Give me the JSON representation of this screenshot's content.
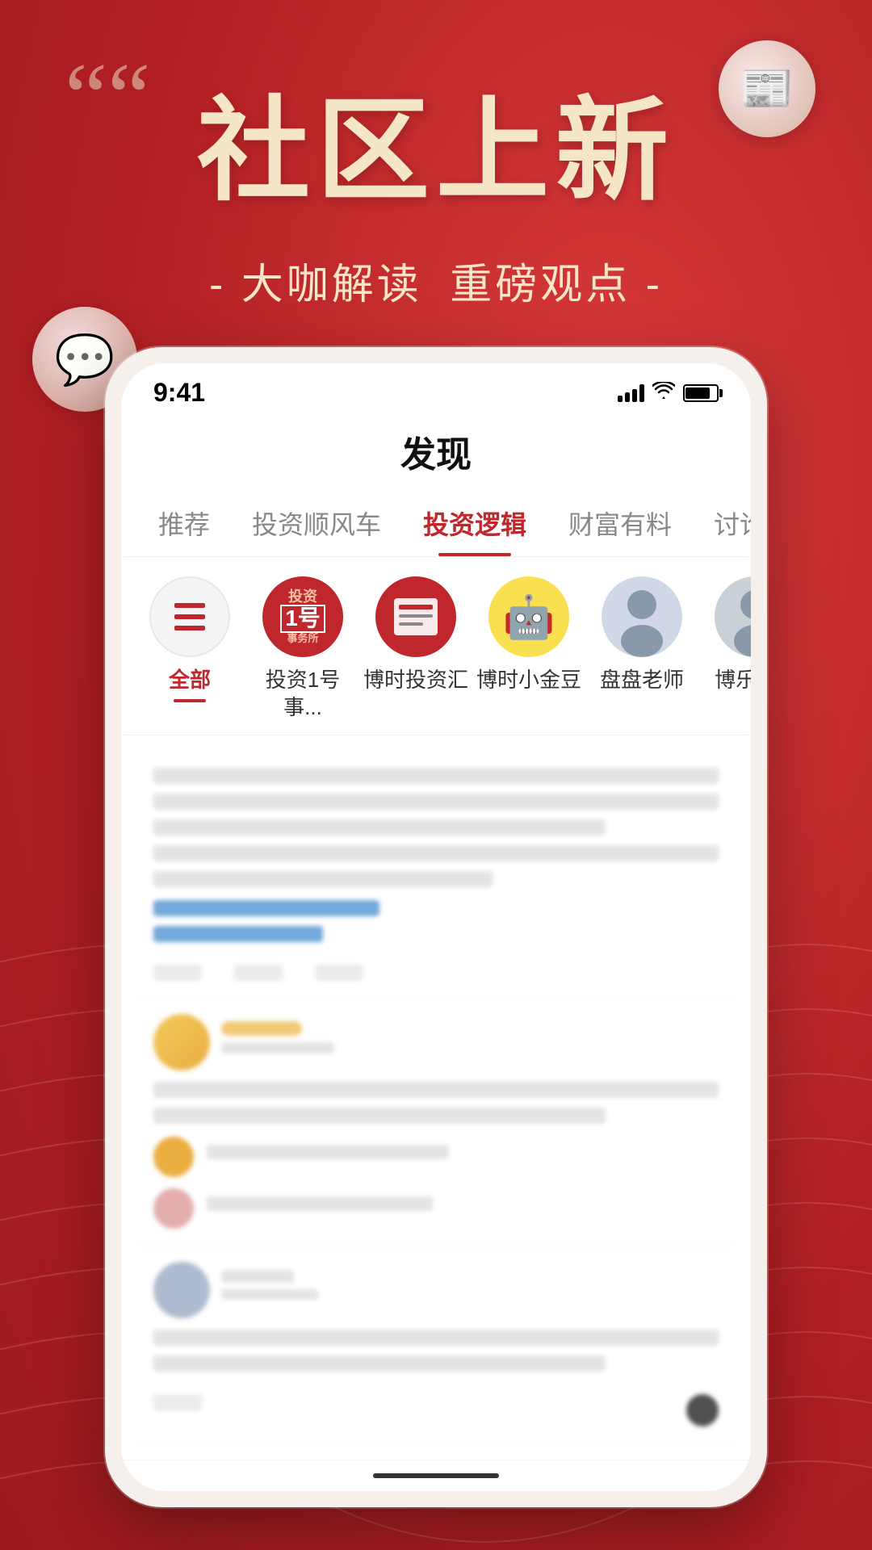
{
  "app": {
    "background_color": "#c0272d",
    "title": "社区上新"
  },
  "hero": {
    "quote_mark": "““",
    "main_title": "社区上新",
    "subtitle_prefix": "- 大咖解读",
    "subtitle_suffix": "重磅观点 -"
  },
  "phone": {
    "status_bar": {
      "time": "9:41"
    },
    "header_title": "发现",
    "nav_tabs": [
      {
        "label": "推荐",
        "active": false
      },
      {
        "label": "投资顺风车",
        "active": false
      },
      {
        "label": "投资逻辑",
        "active": true
      },
      {
        "label": "财富有料",
        "active": false
      },
      {
        "label": "讨论",
        "active": false
      }
    ],
    "channels": [
      {
        "label": "全部",
        "active": true,
        "icon_type": "all"
      },
      {
        "label": "投资1号事...",
        "active": false,
        "icon_type": "newspaper-red"
      },
      {
        "label": "博时投资汇",
        "active": false,
        "icon_type": "newspaper-red2"
      },
      {
        "label": "博时小金豆",
        "active": false,
        "icon_type": "robot-yellow"
      },
      {
        "label": "盘盘老师",
        "active": false,
        "icon_type": "person"
      },
      {
        "label": "博乐德...",
        "active": false,
        "icon_type": "person2"
      }
    ],
    "scrollbar_label": "———"
  }
}
